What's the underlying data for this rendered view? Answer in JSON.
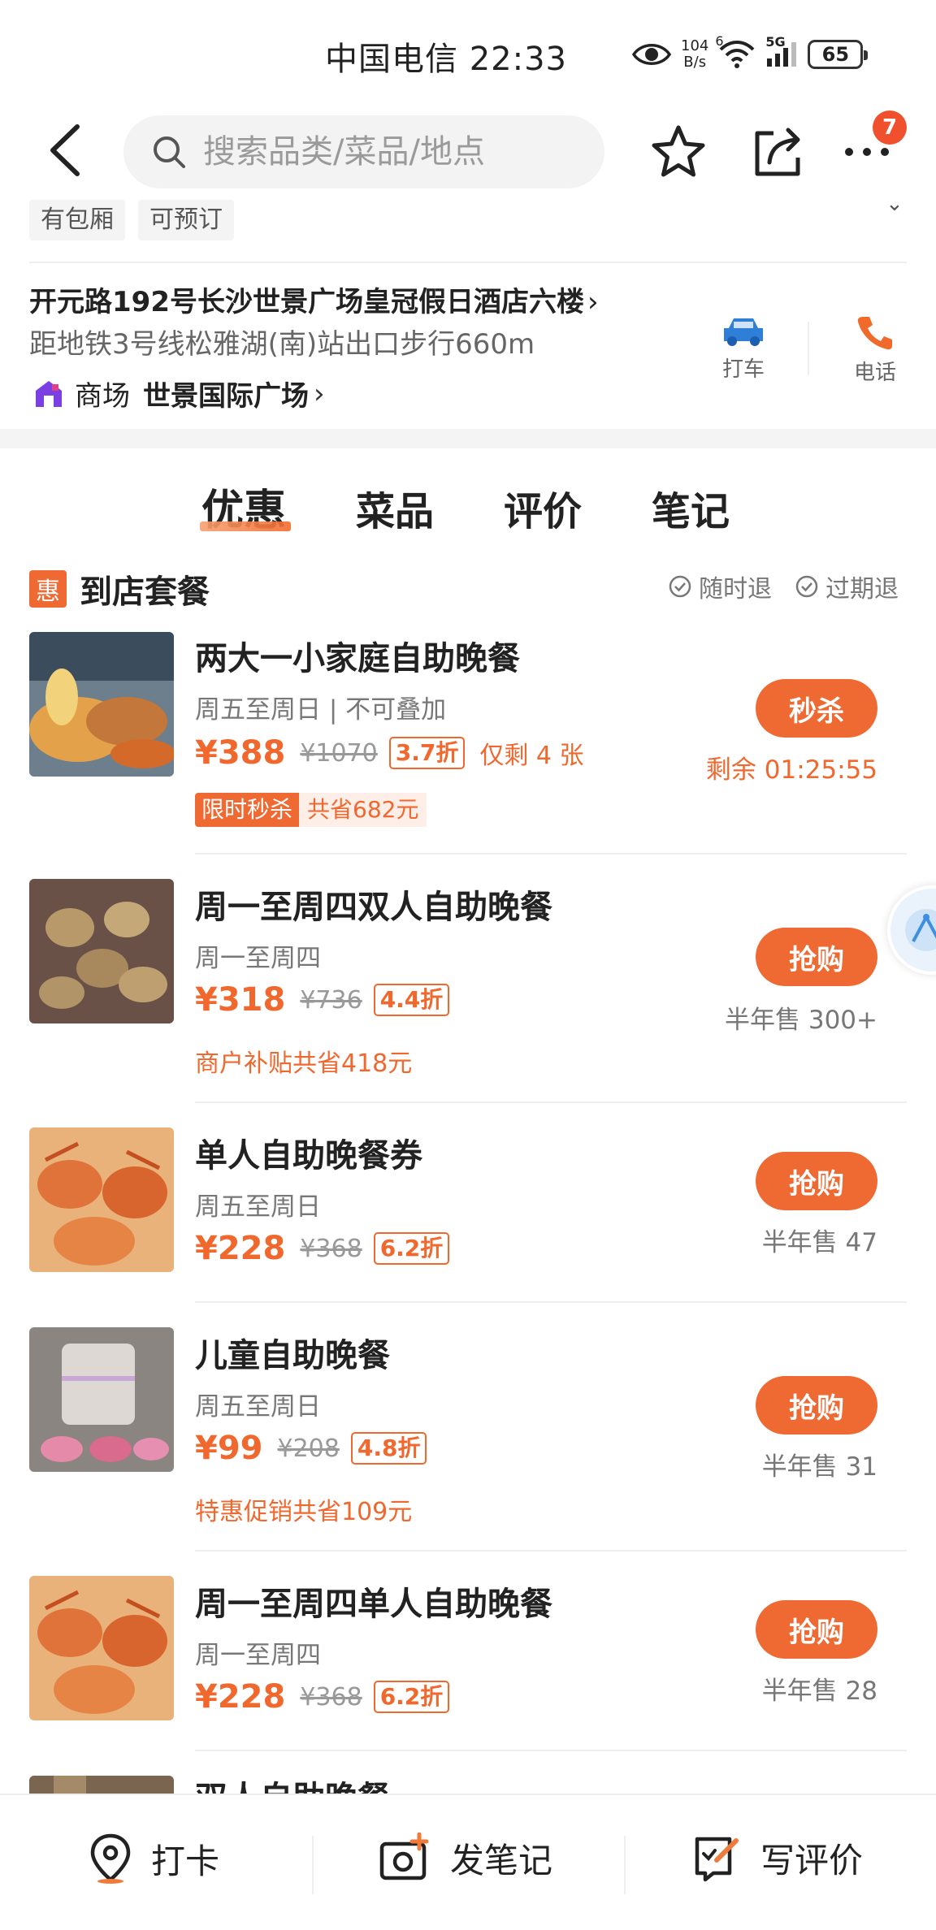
{
  "status_bar": {
    "carrier": "中国电信",
    "time": "22:33",
    "net_speed_value": "104",
    "net_speed_unit": "B/s",
    "signal_label": "5G",
    "wifi_label": "6",
    "battery": "65"
  },
  "nav": {
    "search_placeholder": "搜索品类/菜品/地点",
    "more_badge": "7"
  },
  "info": {
    "tags": [
      "有包厢",
      "可预订"
    ],
    "address": "开元路192号长沙世景广场皇冠假日酒店六楼",
    "metro": "距地铁3号线松雅湖(南)站出口步行660m",
    "mall_type": "商场",
    "mall_name": "世景国际广场",
    "taxi_label": "打车",
    "phone_label": "电话"
  },
  "tabs": [
    {
      "label": "优惠",
      "active": true
    },
    {
      "label": "菜品",
      "active": false
    },
    {
      "label": "评价",
      "active": false
    },
    {
      "label": "笔记",
      "active": false
    }
  ],
  "section": {
    "badge": "惠",
    "title": "到店套餐",
    "policy_1": "随时退",
    "policy_2": "过期退"
  },
  "deals": [
    {
      "title": "两大一小家庭自助晚餐",
      "sub": "周五至周日 | 不可叠加",
      "price": "¥388",
      "original": "¥1070",
      "discount": "3.7折",
      "stock": "仅剩 4 张",
      "flash_tag": "限时秒杀",
      "flash_save": "共省682元",
      "button": "秒杀",
      "right_text": "剩余 01:25:55"
    },
    {
      "title": "周一至周四双人自助晚餐",
      "sub": "周一至周四",
      "price": "¥318",
      "original": "¥736",
      "discount": "4.4折",
      "note": "商户补贴共省418元",
      "button": "抢购",
      "right_text": "半年售 300+"
    },
    {
      "title": "单人自助晚餐券",
      "sub": "周五至周日",
      "price": "¥228",
      "original": "¥368",
      "discount": "6.2折",
      "button": "抢购",
      "right_text": "半年售 47"
    },
    {
      "title": "儿童自助晚餐",
      "sub": "周五至周日",
      "price": "¥99",
      "original": "¥208",
      "discount": "4.8折",
      "note": "特惠促销共省109元",
      "button": "抢购",
      "right_text": "半年售 31"
    },
    {
      "title": "周一至周四单人自助晚餐",
      "sub": "周一至周四",
      "price": "¥228",
      "original": "¥368",
      "discount": "6.2折",
      "button": "抢购",
      "right_text": "半年售 28"
    },
    {
      "title": "双人自助晚餐"
    }
  ],
  "bottom_bar": {
    "checkin": "打卡",
    "note": "发笔记",
    "review": "写评价"
  },
  "colors": {
    "accent": "#ef6a33",
    "price": "#f0682e",
    "badge_red": "#f0502e",
    "taxi_blue": "#2f7fd8",
    "mall_purple": "#7b3fe4"
  }
}
